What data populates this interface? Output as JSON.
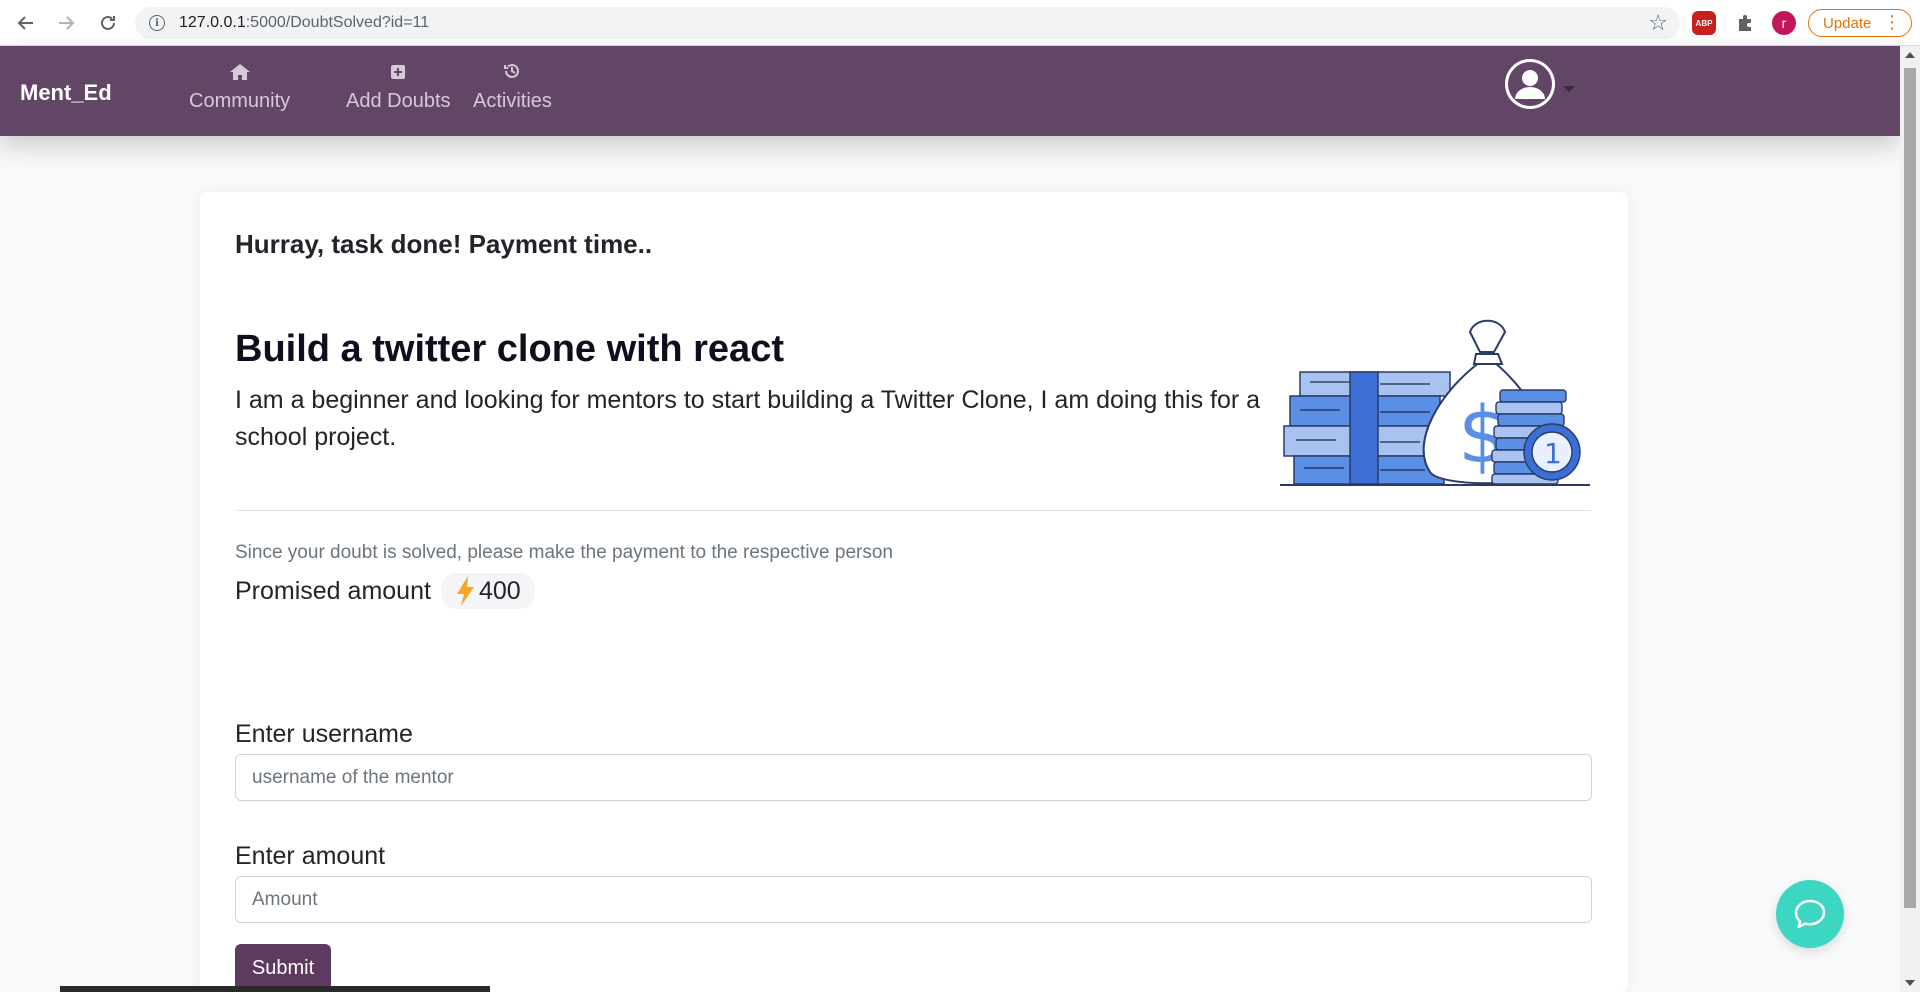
{
  "browser": {
    "url_host": "127.0.0.1",
    "url_rest": ":5000/DoubtSolved?id=11",
    "abp_label": "ABP",
    "profile_initial": "r",
    "update_label": "Update"
  },
  "navbar": {
    "brand": "Ment_Ed",
    "items": [
      {
        "label": "Community",
        "icon": "home-icon"
      },
      {
        "label": "Add Doubts",
        "icon": "plus-square-icon"
      },
      {
        "label": "Activities",
        "icon": "history-icon"
      }
    ]
  },
  "card": {
    "heading": "Hurray, task done! Payment time..",
    "doubt_title": "Build a twitter clone with react",
    "doubt_description": "I am a beginner and looking for mentors to start building a Twitter Clone, I am doing this for a school project.",
    "note": "Since your doubt is solved, please make the payment to the respective person",
    "promised_label": "Promised amount",
    "promised_amount": "400",
    "form": {
      "username_label": "Enter username",
      "username_placeholder": "username of the mentor",
      "amount_label": "Enter amount",
      "amount_placeholder": "Amount",
      "submit_label": "Submit"
    }
  },
  "colors": {
    "navbar": "#624665",
    "submit": "#5d3a5f",
    "chat_fab": "#3dd6c3",
    "bolt": "#f5a623"
  }
}
